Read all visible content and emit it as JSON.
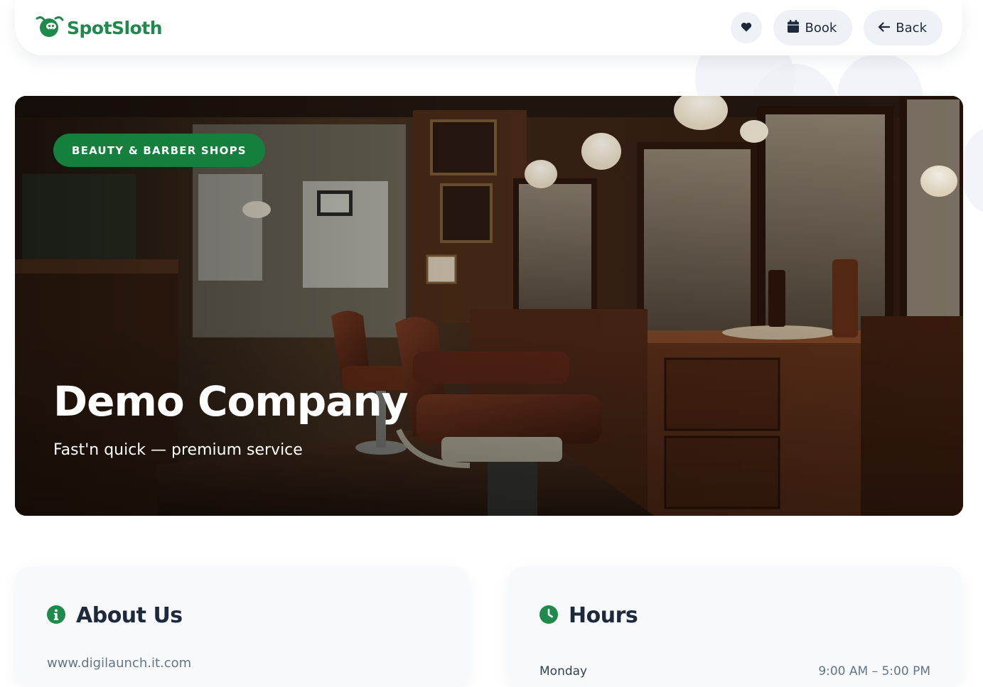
{
  "brand": {
    "name": "SpotSloth",
    "logo_icon": "sloth-logo-icon",
    "color": "#1f8a4c"
  },
  "nav": {
    "favorite_icon": "heart-icon",
    "book_label": "Book",
    "book_icon": "calendar-icon",
    "back_label": "Back",
    "back_icon": "arrow-left-icon"
  },
  "hero": {
    "category": "BEAUTY & BARBER SHOPS",
    "title": "Demo Company",
    "subtitle": "Fast'n quick — premium service",
    "image": "barber-shop-interior-photo",
    "badge_color": "#15803d"
  },
  "about": {
    "title": "About Us",
    "icon": "info-icon",
    "website": "www.digilaunch.it.com"
  },
  "hours": {
    "title": "Hours",
    "icon": "clock-icon",
    "rows": [
      {
        "day": "Monday",
        "time": "9:00 AM – 5:00 PM"
      }
    ]
  }
}
